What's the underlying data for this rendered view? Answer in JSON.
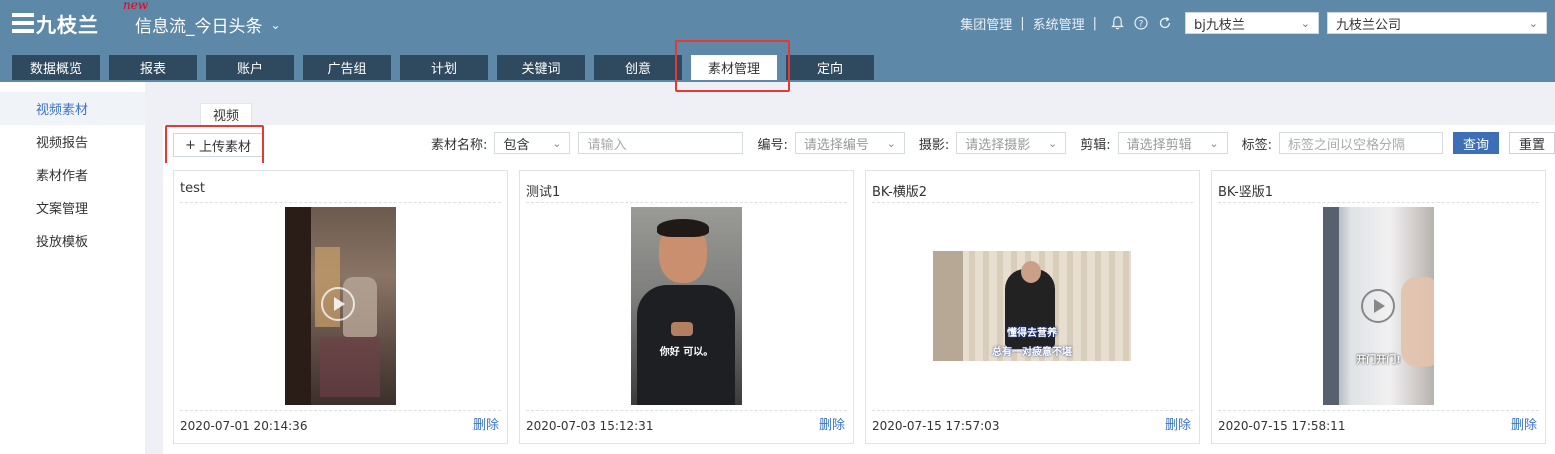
{
  "header": {
    "brand": "九枝兰",
    "new_badge": "new",
    "app_title": "信息流_今日头条",
    "links": [
      "集团管理",
      "系统管理"
    ],
    "account_select": "bj九枝兰",
    "company_select": "九枝兰公司"
  },
  "nav": {
    "tabs": [
      "数据概览",
      "报表",
      "账户",
      "广告组",
      "计划",
      "关键词",
      "创意",
      "素材管理",
      "定向"
    ],
    "active": "素材管理"
  },
  "sidebar": {
    "items": [
      "视频素材",
      "视频报告",
      "素材作者",
      "文案管理",
      "投放模板"
    ],
    "active": "视频素材"
  },
  "subtab": "视频",
  "toolbar": {
    "upload_label": "上传素材",
    "name_label": "素材名称:",
    "name_match": "包含",
    "name_placeholder": "请输入",
    "code_label": "编号:",
    "code_placeholder": "请选择编号",
    "camera_label": "摄影:",
    "camera_placeholder": "请选择摄影",
    "editor_label": "剪辑:",
    "editor_placeholder": "请选择剪辑",
    "tag_label": "标签:",
    "tag_placeholder": "标签之间以空格分隔",
    "query_label": "查询",
    "reset_label": "重置"
  },
  "cards": [
    {
      "title": "test",
      "date": "2020-07-01 20:14:36",
      "delete": "删除"
    },
    {
      "title": "测试1",
      "date": "2020-07-03 15:12:31",
      "delete": "删除",
      "subtitle": "你好 可以。"
    },
    {
      "title": "BK-横版2",
      "date": "2020-07-15 17:57:03",
      "delete": "删除",
      "subtitle1": "懂得去营养",
      "subtitle2": "总有一对疲意不堪"
    },
    {
      "title": "BK-竖版1",
      "date": "2020-07-15 17:58:11",
      "delete": "删除",
      "subtitle": "开门开门!"
    }
  ]
}
